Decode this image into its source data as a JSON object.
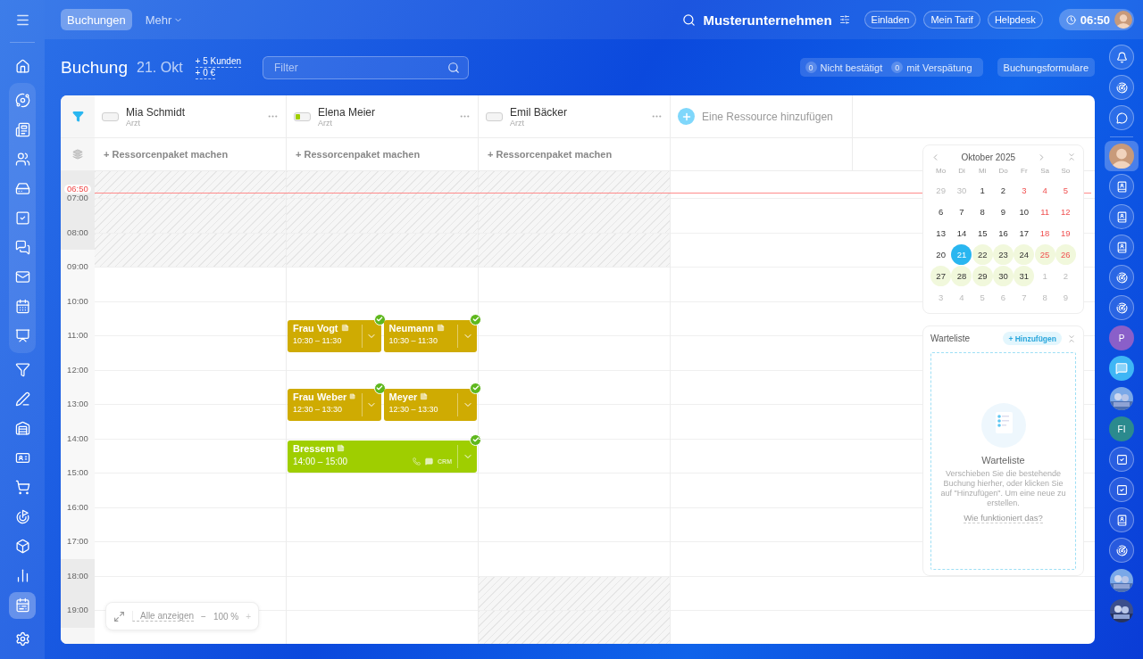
{
  "nav": [
    {
      "selected": false
    },
    {
      "group": [
        {
          "selected": false
        },
        {
          "selected": false
        },
        {
          "selected": false
        },
        {
          "selected": false
        },
        {
          "selected": false
        },
        {
          "selected": false
        },
        {
          "selected": false
        },
        {
          "selected": false
        },
        {
          "selected": false
        }
      ]
    },
    {
      "selected": false
    },
    {
      "selected": false
    },
    {
      "selected": false
    },
    {
      "selected": false
    },
    {
      "selected": false
    },
    {
      "selected": false
    },
    {
      "selected": false
    },
    {
      "selected": false
    },
    {
      "selected": true
    }
  ],
  "top_tabs": [
    {
      "label": "Buchungen",
      "selected": true,
      "dropdown": false
    },
    {
      "label": "Mehr",
      "selected": false,
      "dropdown": true
    }
  ],
  "company": "Musterunternehmen",
  "top_buttons": [
    "Einladen",
    "Mein Tarif",
    "Helpdesk"
  ],
  "clock": "06:50",
  "page": {
    "title": "Buchung",
    "date": "21. Okt",
    "stats": [
      "+ 5 Kunden",
      "+ 0 €"
    ],
    "filter_placeholder": "Filter"
  },
  "status": [
    {
      "count": "0",
      "label": "Nicht bestätigt"
    },
    {
      "count": "0",
      "label": "mit Verspätung"
    }
  ],
  "forms_button": "Buchungsformulare",
  "resources": [
    {
      "name": "Mia Schmidt",
      "role": "Arzt",
      "level": 0,
      "package": "+ Ressorcenpaket machen"
    },
    {
      "name": "Elena Meier",
      "role": "Arzt",
      "level": 0.3,
      "package": "+ Ressorcenpaket machen",
      "bookings": [
        {
          "name": "Frau Vogt",
          "time": "10:30 – 11:30",
          "color": "#cfab02",
          "confirmed": true,
          "contact_icons": false
        },
        {
          "name": "Neumann",
          "time": "10:30 – 11:30",
          "color": "#cfab02",
          "confirmed": true,
          "contact_icons": false
        },
        {
          "name": "Frau Weber",
          "time": "12:30 – 13:30",
          "color": "#cfab02",
          "confirmed": true,
          "contact_icons": false
        },
        {
          "name": "Meyer",
          "time": "12:30 – 13:30",
          "color": "#cfab02",
          "confirmed": true,
          "contact_icons": false
        },
        {
          "name": "Bressem",
          "time": "14:00 – 15:00",
          "color": "#9fce00",
          "confirmed": true,
          "contact_icons": true,
          "crm": "CRM"
        }
      ]
    },
    {
      "name": "Emil Bäcker",
      "role": "Arzt",
      "level": 0,
      "package": "+ Ressorcenpaket machen"
    }
  ],
  "add_resource": "Eine Ressource hinzufügen",
  "hours": [
    {
      "label": "07:00",
      "closed": true,
      "blocked": [
        true,
        true,
        true
      ]
    },
    {
      "label": "08:00",
      "closed": true,
      "blocked": [
        true,
        true,
        true
      ]
    },
    {
      "label": "09:00",
      "closed": false,
      "blocked": [
        false,
        false,
        false
      ]
    },
    {
      "label": "10:00",
      "closed": false,
      "blocked": [
        false,
        false,
        false
      ]
    },
    {
      "label": "11:00",
      "closed": false,
      "blocked": [
        false,
        false,
        false
      ]
    },
    {
      "label": "12:00",
      "closed": false,
      "blocked": [
        false,
        false,
        false
      ]
    },
    {
      "label": "13:00",
      "closed": false,
      "blocked": [
        false,
        false,
        false
      ]
    },
    {
      "label": "14:00",
      "closed": false,
      "blocked": [
        false,
        false,
        false
      ]
    },
    {
      "label": "15:00",
      "closed": false,
      "blocked": [
        false,
        false,
        false
      ]
    },
    {
      "label": "16:00",
      "closed": false,
      "blocked": [
        false,
        false,
        false
      ]
    },
    {
      "label": "17:00",
      "closed": false,
      "blocked": [
        false,
        false,
        false
      ]
    },
    {
      "label": "18:00",
      "closed": true,
      "blocked": [
        false,
        false,
        true
      ]
    },
    {
      "label": "19:00",
      "closed": true,
      "blocked": [
        false,
        false,
        true
      ]
    }
  ],
  "now": "06:50",
  "zoom": {
    "show_all": "Alle anzeigen",
    "minus": "−",
    "value": "100 %",
    "plus": "+"
  },
  "calendar": {
    "title": "Oktober 2025",
    "weekdays": [
      "Mo",
      "Di",
      "Mi",
      "Do",
      "Fr",
      "Sa",
      "So"
    ],
    "weeks": [
      [
        {
          "day": "29",
          "muted": true,
          "marked": false,
          "selected": false
        },
        {
          "day": "30",
          "muted": true,
          "marked": false,
          "selected": false
        },
        {
          "day": "1",
          "muted": false,
          "weekend": false,
          "marked": false,
          "selected": false
        },
        {
          "day": "2",
          "muted": false,
          "weekend": false,
          "marked": false,
          "selected": false
        },
        {
          "day": "3",
          "muted": false,
          "weekend": true,
          "marked": false,
          "selected": false
        },
        {
          "day": "4",
          "muted": false,
          "weekend": true,
          "marked": false,
          "selected": false
        },
        {
          "day": "5",
          "muted": false,
          "weekend": true,
          "marked": false,
          "selected": false
        }
      ],
      [
        {
          "day": "6",
          "muted": false,
          "weekend": false,
          "marked": false,
          "selected": false
        },
        {
          "day": "7",
          "muted": false,
          "weekend": false,
          "marked": false,
          "selected": false
        },
        {
          "day": "8",
          "muted": false,
          "weekend": false,
          "marked": false,
          "selected": false
        },
        {
          "day": "9",
          "muted": false,
          "weekend": false,
          "marked": false,
          "selected": false
        },
        {
          "day": "10",
          "muted": false,
          "weekend": false,
          "marked": false,
          "selected": false
        },
        {
          "day": "11",
          "muted": false,
          "weekend": true,
          "marked": false,
          "selected": false
        },
        {
          "day": "12",
          "muted": false,
          "weekend": true,
          "marked": false,
          "selected": false
        }
      ],
      [
        {
          "day": "13",
          "muted": false,
          "weekend": false,
          "marked": false,
          "selected": false
        },
        {
          "day": "14",
          "muted": false,
          "weekend": false,
          "marked": false,
          "selected": false
        },
        {
          "day": "15",
          "muted": false,
          "weekend": false,
          "marked": false,
          "selected": false
        },
        {
          "day": "16",
          "muted": false,
          "weekend": false,
          "marked": false,
          "selected": false
        },
        {
          "day": "17",
          "muted": false,
          "weekend": false,
          "marked": false,
          "selected": false
        },
        {
          "day": "18",
          "muted": false,
          "weekend": true,
          "marked": false,
          "selected": false
        },
        {
          "day": "19",
          "muted": false,
          "weekend": true,
          "marked": false,
          "selected": false
        }
      ],
      [
        {
          "day": "20",
          "muted": false,
          "weekend": false,
          "marked": false,
          "selected": false
        },
        {
          "day": "21",
          "muted": false,
          "weekend": false,
          "marked": false,
          "selected": true
        },
        {
          "day": "22",
          "muted": false,
          "weekend": false,
          "marked": true,
          "selected": false
        },
        {
          "day": "23",
          "muted": false,
          "weekend": false,
          "marked": true,
          "selected": false
        },
        {
          "day": "24",
          "muted": false,
          "weekend": false,
          "marked": true,
          "selected": false
        },
        {
          "day": "25",
          "muted": false,
          "weekend": true,
          "marked": true,
          "selected": false
        },
        {
          "day": "26",
          "muted": false,
          "weekend": true,
          "marked": true,
          "selected": false
        }
      ],
      [
        {
          "day": "27",
          "muted": false,
          "weekend": false,
          "marked": true,
          "selected": false
        },
        {
          "day": "28",
          "muted": false,
          "weekend": false,
          "marked": true,
          "selected": false
        },
        {
          "day": "29",
          "muted": false,
          "weekend": false,
          "marked": true,
          "selected": false
        },
        {
          "day": "30",
          "muted": false,
          "weekend": false,
          "marked": true,
          "selected": false
        },
        {
          "day": "31",
          "muted": false,
          "weekend": false,
          "marked": true,
          "selected": false
        },
        {
          "day": "1",
          "muted": true,
          "marked": false,
          "selected": false
        },
        {
          "day": "2",
          "muted": true,
          "marked": false,
          "selected": false
        }
      ],
      [
        {
          "day": "3",
          "muted": true,
          "marked": false,
          "selected": false
        },
        {
          "day": "4",
          "muted": true,
          "marked": false,
          "selected": false
        },
        {
          "day": "5",
          "muted": true,
          "marked": false,
          "selected": false
        },
        {
          "day": "6",
          "muted": true,
          "marked": false,
          "selected": false
        },
        {
          "day": "7",
          "muted": true,
          "marked": false,
          "selected": false
        },
        {
          "day": "8",
          "muted": true,
          "marked": false,
          "selected": false
        },
        {
          "day": "9",
          "muted": true,
          "marked": false,
          "selected": false
        }
      ]
    ]
  },
  "waitlist": {
    "title": "Warteliste",
    "add": "+ Hinzufügen",
    "heading": "Warteliste",
    "text": "Verschieben Sie die bestehende Buchung hierher, oder klicken Sie auf \"Hinzufügen\". Um eine neue zu erstellen.",
    "link": "Wie funktioniert das?"
  },
  "rail": [
    {
      "kind": "icon",
      "selected": false
    },
    {
      "kind": "icon",
      "selected": false
    },
    {
      "kind": "icon",
      "selected": false
    },
    {
      "kind": "divider"
    },
    {
      "kind": "avatar",
      "selected": true
    },
    {
      "kind": "icon",
      "selected": false
    },
    {
      "kind": "icon",
      "selected": false
    },
    {
      "kind": "icon",
      "selected": false
    },
    {
      "kind": "icon",
      "selected": false
    },
    {
      "kind": "icon",
      "selected": false
    },
    {
      "kind": "letter",
      "text": "P",
      "color": "#8a5fc9",
      "selected": false
    },
    {
      "kind": "chat",
      "selected": false
    },
    {
      "kind": "picture",
      "selected": false
    },
    {
      "kind": "letter",
      "text": "FI",
      "color": "#2b8a8e",
      "selected": false
    },
    {
      "kind": "icon",
      "selected": false
    },
    {
      "kind": "icon",
      "selected": false
    },
    {
      "kind": "icon",
      "selected": false
    },
    {
      "kind": "icon",
      "selected": false
    },
    {
      "kind": "picture",
      "selected": false
    },
    {
      "kind": "picture",
      "selected": false
    }
  ]
}
